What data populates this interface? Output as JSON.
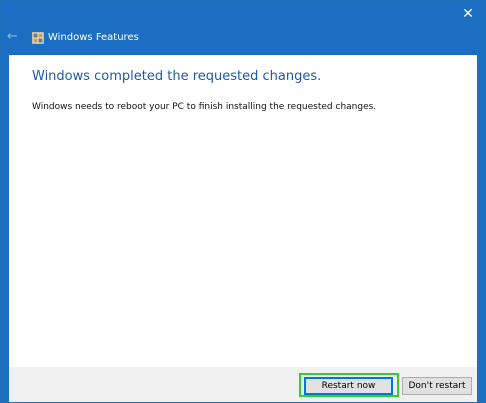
{
  "window": {
    "title": "Windows Features",
    "close_glyph": "✕",
    "back_glyph": "←",
    "accent_color": "#1b6ec2"
  },
  "icons": {
    "back": "back-arrow-icon",
    "app": "windows-features-icon",
    "close": "close-icon"
  },
  "content": {
    "heading": "Windows completed the requested changes.",
    "message": "Windows needs to reboot your PC to finish installing the requested changes."
  },
  "footer": {
    "restart_label": "Restart now",
    "dont_restart_label": "Don't restart",
    "highlight_color": "#2fd12f"
  }
}
